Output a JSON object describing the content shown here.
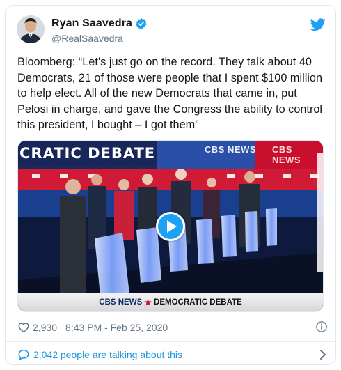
{
  "tweet": {
    "display_name": "Ryan Saavedra",
    "handle": "@RealSaavedra",
    "text": "Bloomberg: “Let’s just go on the record. They talk about 40 Democrats, 21 of those were people that I spent $100 million to help elect. All of the new Democrats that came in, put Pelosi in charge, and gave the Congress the ability to control this president, I bought – I got them”",
    "likes": "2,930",
    "timestamp": "8:43 PM - Feb 25, 2020",
    "talking": "2,042 people are talking about this"
  },
  "media": {
    "banner_text": "CRATIC DEBATE",
    "cbs_top_left": "CBS NEWS",
    "cbs_top_right": "CBS NEWS",
    "bottom_brand": "CBS NEWS",
    "bottom_title": "DEMOCRATIC DEBATE",
    "bottom_star": "★"
  },
  "colors": {
    "accent": "#1da1f2",
    "link": "#1b95e0",
    "muted": "#657786",
    "stage_red": "#c8102e",
    "stage_blue": "#1b3f8f"
  },
  "icons": {
    "verified": "verified-badge-icon",
    "logo": "twitter-bird-icon",
    "like": "heart-icon",
    "info": "info-icon",
    "reply": "speech-bubble-icon",
    "more": "chevron-right-icon",
    "play": "play-icon"
  }
}
